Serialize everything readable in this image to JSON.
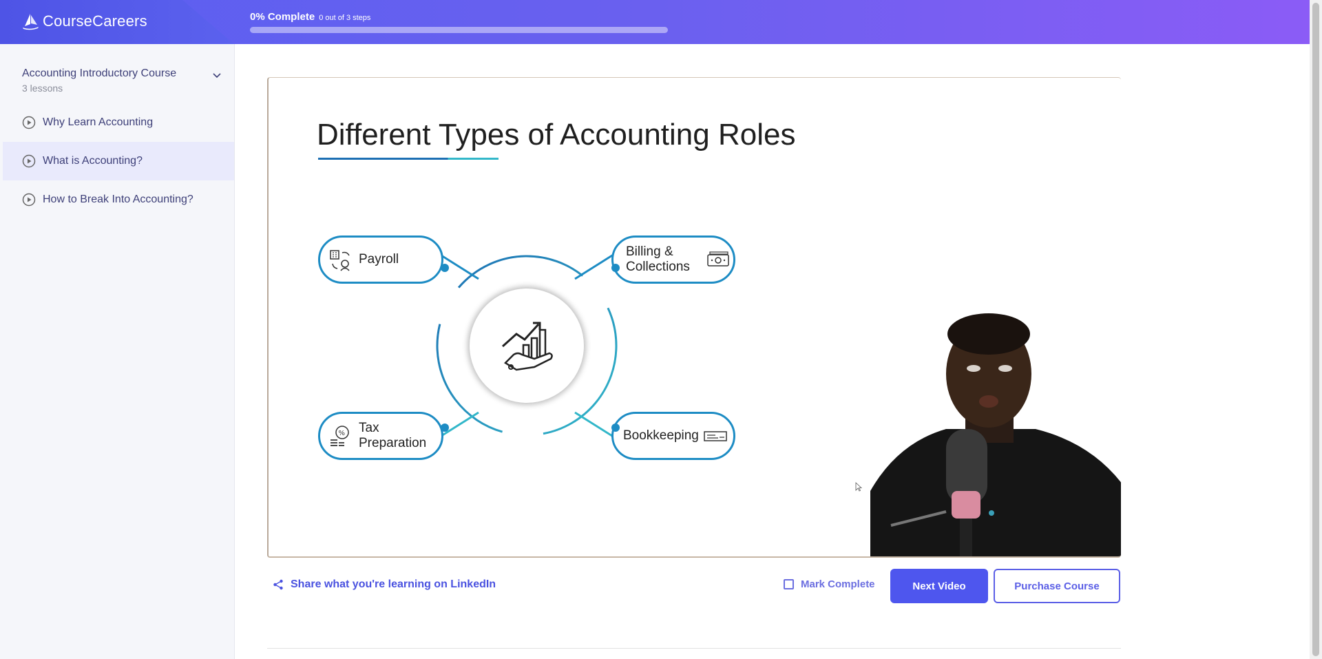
{
  "header": {
    "brand": "CourseCareers",
    "progress_percent_label": "0% Complete",
    "progress_steps_label": "0 out of 3 steps",
    "progress_fraction": 0
  },
  "sidebar": {
    "course_title": "Accounting Introductory Course",
    "course_sub": "3 lessons",
    "lessons": [
      {
        "label": "Why Learn Accounting",
        "active": false
      },
      {
        "label": "What is Accounting?",
        "active": true
      },
      {
        "label": "How to Break Into Accounting?",
        "active": false
      }
    ]
  },
  "video": {
    "slide_title": "Different Types of Accounting Roles",
    "roles": {
      "payroll": "Payroll",
      "billing_line1": "Billing &",
      "billing_line2": "Collections",
      "tax_line1": "Tax",
      "tax_line2": "Preparation",
      "bookkeeping": "Bookkeeping"
    }
  },
  "actions": {
    "share_label": "Share what you're learning on LinkedIn",
    "mark_complete_label": "Mark Complete",
    "next_label": "Next Video",
    "purchase_label": "Purchase Course"
  },
  "colors": {
    "accent": "#4e56ee",
    "header_start": "#5a5ff0",
    "header_end": "#8b5cf6",
    "slide_blue": "#1d8cc4"
  },
  "icons": [
    "logo-sail-icon",
    "chevron-down-icon",
    "play-circle-icon",
    "share-icon",
    "payroll-icon",
    "cash-icon",
    "tax-icon",
    "check-icon",
    "growth-hand-icon",
    "cursor-icon"
  ]
}
